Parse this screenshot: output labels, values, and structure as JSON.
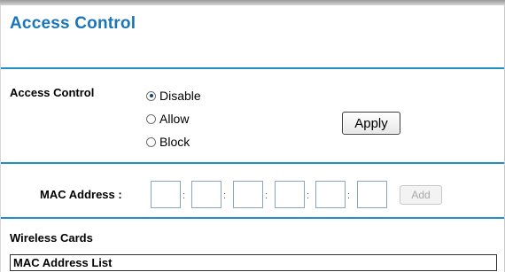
{
  "page": {
    "title": "Access Control"
  },
  "access_control": {
    "label": "Access Control",
    "options": [
      {
        "label": "Disable",
        "selected": true
      },
      {
        "label": "Allow",
        "selected": false
      },
      {
        "label": "Block",
        "selected": false
      }
    ],
    "apply_label": "Apply"
  },
  "mac_entry": {
    "label": "MAC Address :",
    "octets": [
      "",
      "",
      "",
      "",
      "",
      ""
    ],
    "separators": [
      ":",
      ":",
      ":",
      ":",
      ":"
    ],
    "add_label": "Add",
    "add_enabled": false
  },
  "wireless_cards": {
    "heading": "Wireless Cards",
    "list_header": "MAC Address List"
  },
  "colors": {
    "title": "#1a76b8",
    "rule": "#1e8fc7",
    "field_border": "#8aa4c4"
  }
}
